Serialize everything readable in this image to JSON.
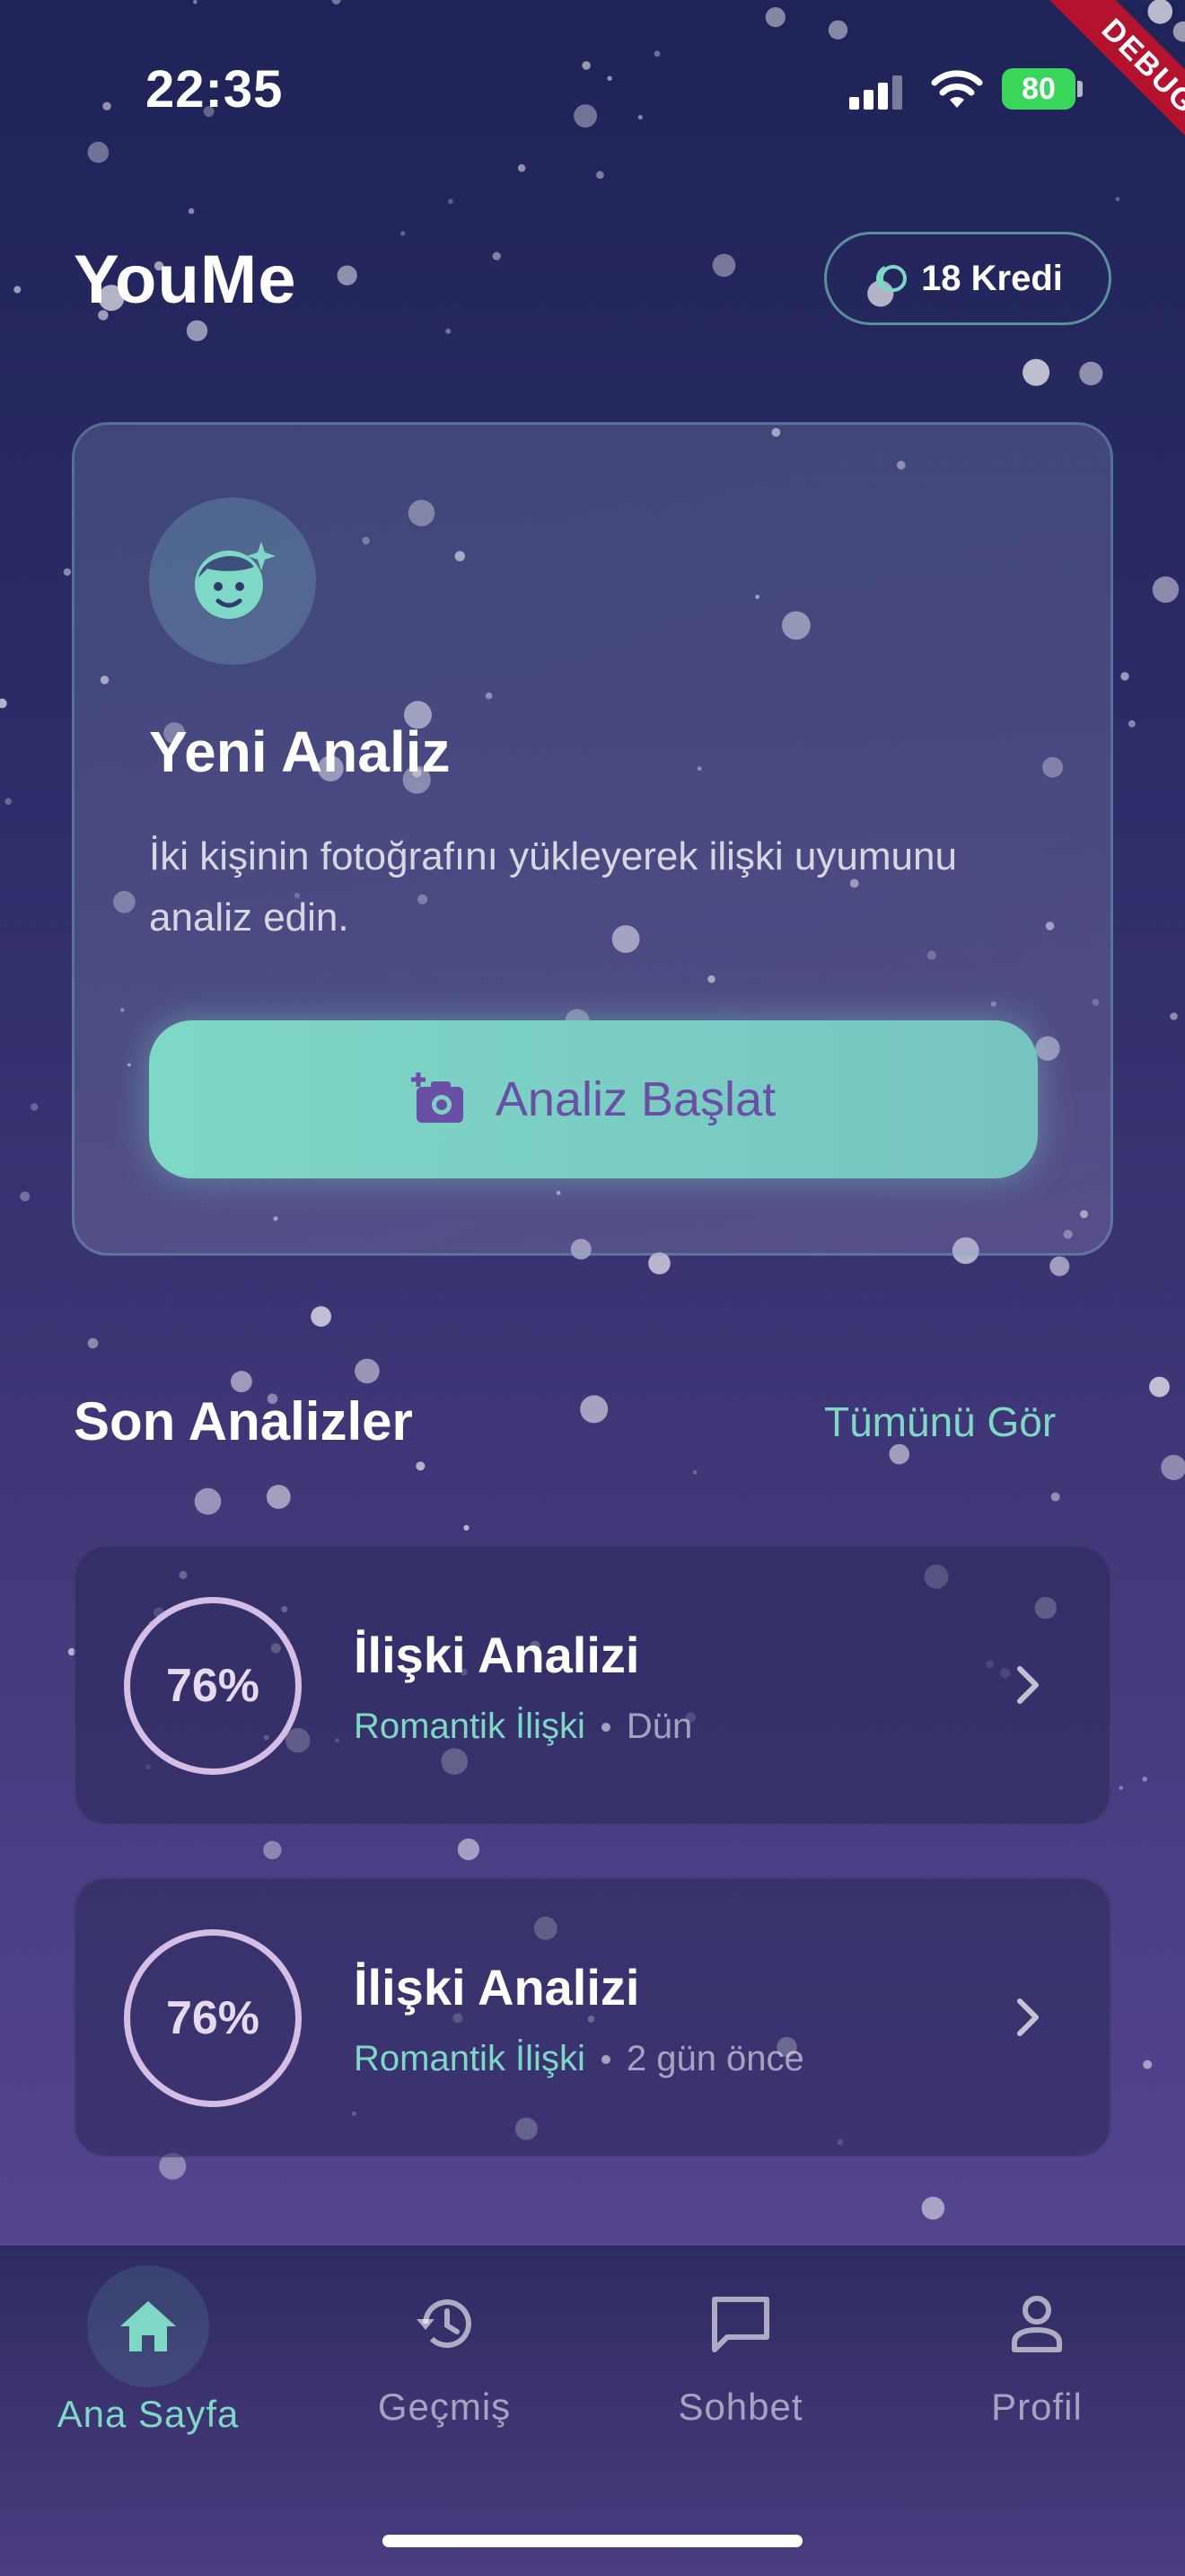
{
  "status_bar": {
    "time": "22:35",
    "battery": "80",
    "debug": "DEBUG"
  },
  "header": {
    "title": "YouMe",
    "credits": "18 Kredi",
    "credit_icon": "coin-icon"
  },
  "hero": {
    "icon": "face-sparkle-icon",
    "title": "Yeni Analiz",
    "description": "İki kişinin fotoğrafını yükleyerek ilişki uyumunu analiz edin.",
    "button_label": "Analiz Başlat",
    "button_icon": "add-photo-icon"
  },
  "recent": {
    "title": "Son Analizler",
    "see_all": "Tümünü Gör",
    "items": [
      {
        "score": "76%",
        "title": "İlişki Analizi",
        "type": "Romantik İlişki",
        "when": "Dün"
      },
      {
        "score": "76%",
        "title": "İlişki Analizi",
        "type": "Romantik İlişki",
        "when": "2 gün önce"
      }
    ]
  },
  "nav": {
    "items": [
      {
        "label": "Ana Sayfa",
        "icon": "home-icon",
        "active": true
      },
      {
        "label": "Geçmiş",
        "icon": "history-icon",
        "active": false
      },
      {
        "label": "Sohbet",
        "icon": "chat-icon",
        "active": false
      },
      {
        "label": "Profil",
        "icon": "profile-icon",
        "active": false
      }
    ]
  },
  "colors": {
    "accent": "#7fd8c6",
    "button_text": "#6a4fa6",
    "ring": "#d6bde6"
  }
}
